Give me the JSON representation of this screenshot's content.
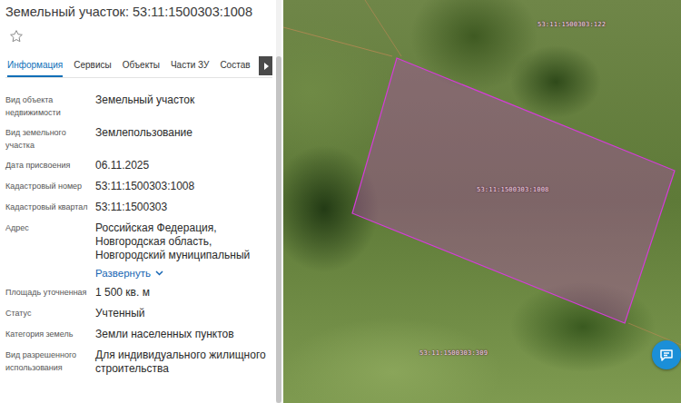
{
  "panel": {
    "title": "Земельный участок: 53:11:1500303:1008"
  },
  "tabs": [
    {
      "label": "Информация",
      "selected": true
    },
    {
      "label": "Сервисы",
      "selected": false
    },
    {
      "label": "Объекты",
      "selected": false
    },
    {
      "label": "Части ЗУ",
      "selected": false
    },
    {
      "label": "Состав",
      "selected": false
    }
  ],
  "fields": [
    {
      "label": "Вид объекта недвижимости",
      "value": "Земельный участок"
    },
    {
      "label": "Вид земельного участка",
      "value": "Землепользование"
    },
    {
      "label": "Дата присвоения",
      "value": "06.11.2025"
    },
    {
      "label": "Кадастровый номер",
      "value": "53:11:1500303:1008"
    },
    {
      "label": "Кадастровый квартал",
      "value": "53:11:1500303"
    },
    {
      "label": "Адрес",
      "value": "Российская Федерация, Новгородская область, Новгородский муниципальный",
      "link": "Развернуть"
    },
    {
      "label": "Площадь уточненная",
      "value": "1 500 кв. м"
    },
    {
      "label": "Статус",
      "value": "Учтенный"
    },
    {
      "label": "Категория земель",
      "value": "Земли населенных пунктов"
    },
    {
      "label": "Вид разрешенного использования",
      "value": "Для индивидуального жилищного строительства"
    }
  ],
  "map": {
    "parcels": [
      {
        "label": "53:11:1500303:1008",
        "selected": true
      },
      {
        "label": "53:11:1500303:122",
        "selected": false
      },
      {
        "label": "53:11:1500303:309",
        "selected": false
      }
    ]
  }
}
